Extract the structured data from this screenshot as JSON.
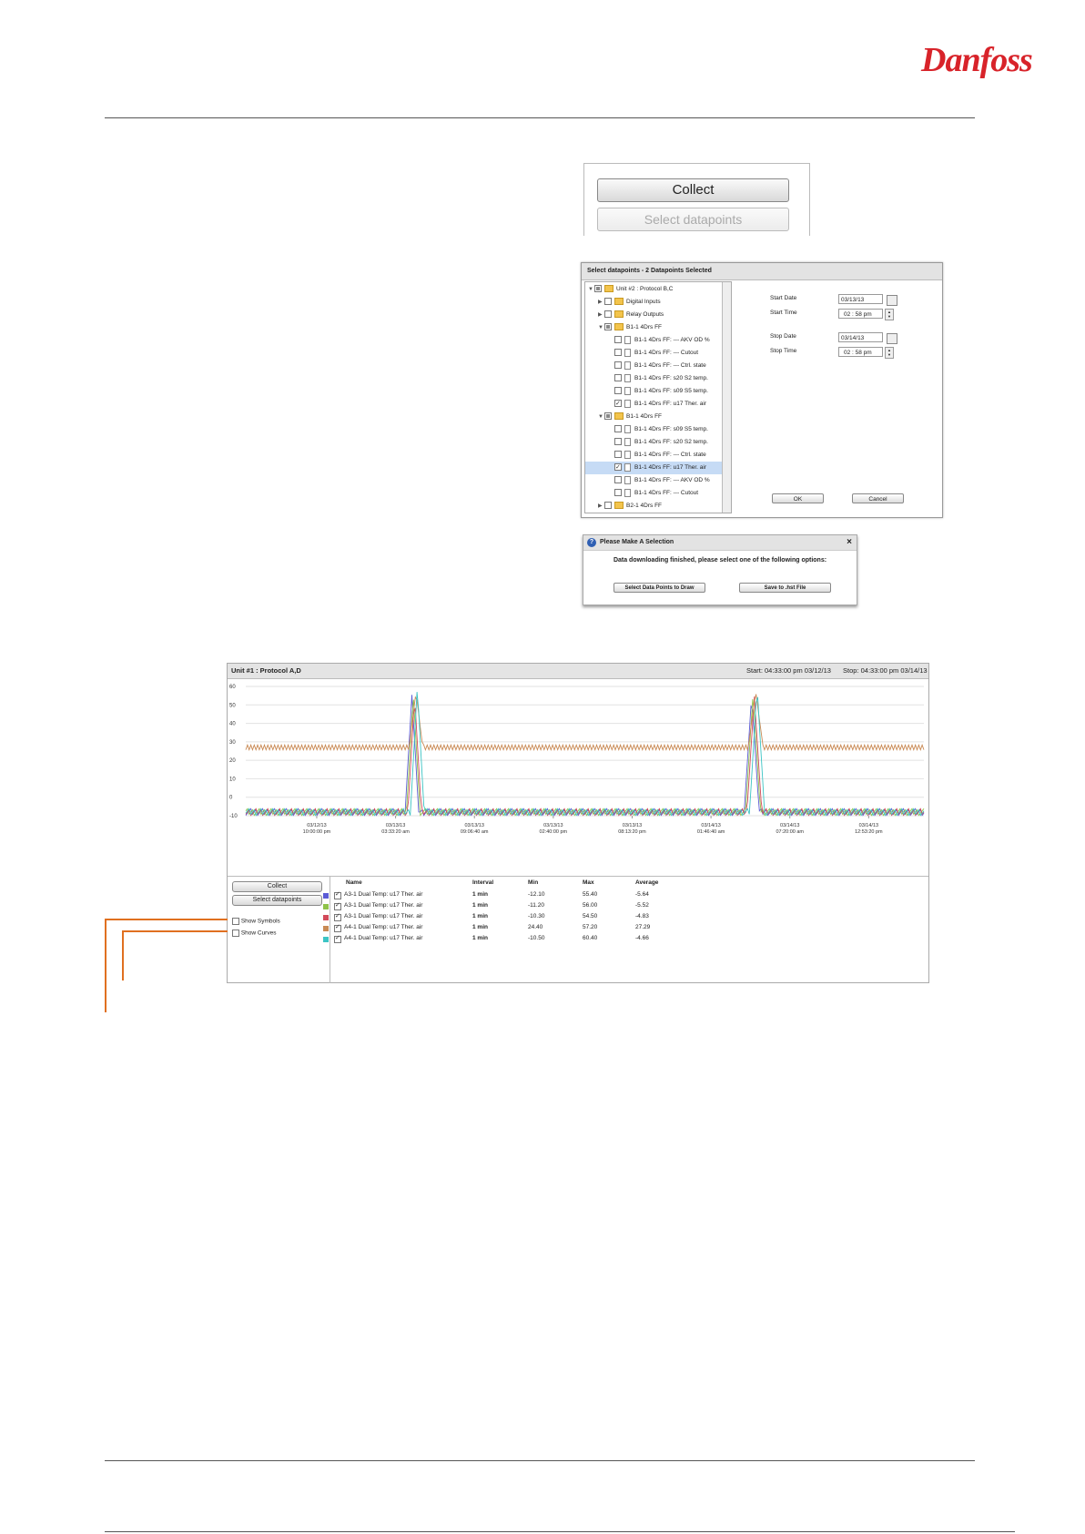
{
  "logo": {
    "text": "Danfoss",
    "color": "#d8232a"
  },
  "collect_panel": {
    "collect_label": "Collect",
    "select_label": "Select datapoints"
  },
  "select_dialog": {
    "title": "Select datapoints - 2 Datapoints Selected",
    "tree": [
      {
        "label": "Unit #2 : Protocol B,C",
        "level": 0,
        "arrow": "▼",
        "check": "part",
        "icon": "folder"
      },
      {
        "label": "Digital Inputs",
        "level": 1,
        "arrow": "▶",
        "check": "off",
        "icon": "folder"
      },
      {
        "label": "Relay Outputs",
        "level": 1,
        "arrow": "▶",
        "check": "off",
        "icon": "folder"
      },
      {
        "label": "B1-1 4Drs FF",
        "level": 1,
        "arrow": "▼",
        "check": "part",
        "icon": "folder"
      },
      {
        "label": "B1-1 4Drs FF:   --- AKV OD %",
        "level": 2,
        "arrow": "",
        "check": "off",
        "icon": "doc"
      },
      {
        "label": "B1-1 4Drs FF:   --- Cutout",
        "level": 2,
        "arrow": "",
        "check": "off",
        "icon": "doc"
      },
      {
        "label": "B1-1 4Drs FF:   --- Ctrl. state",
        "level": 2,
        "arrow": "",
        "check": "off",
        "icon": "doc"
      },
      {
        "label": "B1-1 4Drs FF:   s20 S2 temp.",
        "level": 2,
        "arrow": "",
        "check": "off",
        "icon": "doc"
      },
      {
        "label": "B1-1 4Drs FF:   s09 S5 temp.",
        "level": 2,
        "arrow": "",
        "check": "off",
        "icon": "doc"
      },
      {
        "label": "B1-1 4Drs FF:   u17 Ther. air",
        "level": 2,
        "arrow": "",
        "check": "on",
        "icon": "doc"
      },
      {
        "label": "B1-1 4Drs FF",
        "level": 1,
        "arrow": "▼",
        "check": "part",
        "icon": "folder"
      },
      {
        "label": "B1-1 4Drs FF:   s09 S5 temp.",
        "level": 2,
        "arrow": "",
        "check": "off",
        "icon": "doc"
      },
      {
        "label": "B1-1 4Drs FF:   s20 S2 temp.",
        "level": 2,
        "arrow": "",
        "check": "off",
        "icon": "doc"
      },
      {
        "label": "B1-1 4Drs FF:   --- Ctrl. state",
        "level": 2,
        "arrow": "",
        "check": "off",
        "icon": "doc"
      },
      {
        "label": "B1-1 4Drs FF:   u17 Ther. air",
        "level": 2,
        "arrow": "",
        "check": "on",
        "icon": "doc",
        "selected": true
      },
      {
        "label": "B1-1 4Drs FF:   --- AKV OD %",
        "level": 2,
        "arrow": "",
        "check": "off",
        "icon": "doc"
      },
      {
        "label": "B1-1 4Drs FF:   --- Cutout",
        "level": 2,
        "arrow": "",
        "check": "off",
        "icon": "doc"
      },
      {
        "label": "B2-1 4Drs FF",
        "level": 1,
        "arrow": "▶",
        "check": "off",
        "icon": "folder"
      }
    ],
    "start_date_label": "Start Date",
    "start_date": "03/13/13",
    "start_time_label": "Start Time",
    "start_time": "02 : 58  pm",
    "stop_date_label": "Stop Date",
    "stop_date": "03/14/13",
    "stop_time_label": "Stop Time",
    "stop_time": "02 : 58  pm",
    "ok_label": "OK",
    "cancel_label": "Cancel"
  },
  "message_dialog": {
    "title": "Please Make A Selection",
    "close": "×",
    "message": "Data downloading finished, please select one of the following options:",
    "draw_label": "Select Data Points to Draw",
    "save_label": "Save to .hst File"
  },
  "chart_window": {
    "title": "Unit #1 : Protocol A,D",
    "start": "Start: 04:33:00 pm  03/12/13",
    "stop": "Stop: 04:33:00 pm  03/14/13",
    "collect_label": "Collect",
    "select_label": "Select datapoints",
    "show_symbols": "Show Symbols",
    "show_curves": "Show Curves",
    "columns": {
      "name": "Name",
      "interval": "Interval",
      "min": "Min",
      "max": "Max",
      "average": "Average"
    },
    "legend_rows": [
      {
        "color": "#5b5bd6",
        "name": "A3-1 Dual Temp:   u17 Ther. air",
        "interval": "1 min",
        "min": "-12.10",
        "max": "55.40",
        "average": "-5.64"
      },
      {
        "color": "#8fc34a",
        "name": "A3-1 Dual Temp:   u17 Ther. air",
        "interval": "1 min",
        "min": "-11.20",
        "max": "56.00",
        "average": "-5.52"
      },
      {
        "color": "#d24a5a",
        "name": "A3-1 Dual Temp:   u17 Ther. air",
        "interval": "1 min",
        "min": "-10.30",
        "max": "54.50",
        "average": "-4.83"
      },
      {
        "color": "#c98a55",
        "name": "A4-1 Dual Temp:   u17 Ther. air",
        "interval": "1 min",
        "min": "24.40",
        "max": "57.20",
        "average": "27.29"
      },
      {
        "color": "#3cc4c4",
        "name": "A4-1 Dual Temp:   u17 Ther. air",
        "interval": "1 min",
        "min": "-10.50",
        "max": "60.40",
        "average": "-4.66"
      }
    ]
  },
  "chart_data": {
    "type": "line",
    "title": "",
    "xlabel": "",
    "ylabel": "",
    "ylim": [
      -10,
      60
    ],
    "yticks": [
      -10,
      0,
      10,
      20,
      30,
      40,
      50,
      60
    ],
    "xticks": [
      {
        "date": "03/12/13",
        "time": "10:00:00 pm"
      },
      {
        "date": "03/13/13",
        "time": "03:33:20 am"
      },
      {
        "date": "03/13/13",
        "time": "09:06:40 am"
      },
      {
        "date": "03/13/13",
        "time": "02:40:00 pm"
      },
      {
        "date": "03/13/13",
        "time": "08:13:20 pm"
      },
      {
        "date": "03/14/13",
        "time": "01:46:40 am"
      },
      {
        "date": "03/14/13",
        "time": "07:20:00 am"
      },
      {
        "date": "03/14/13",
        "time": "12:53:20 pm"
      }
    ],
    "grid": true,
    "series": [
      {
        "name": "A3-1 Dual Temp:   u17 Ther. air",
        "color": "#5b5bd6",
        "base": -8,
        "peak": 55.4
      },
      {
        "name": "A3-1 Dual Temp:   u17 Ther. air",
        "color": "#8fc34a",
        "base": -8,
        "peak": 56.0
      },
      {
        "name": "A3-1 Dual Temp:   u17 Ther. air",
        "color": "#d24a5a",
        "base": -8,
        "peak": 54.5
      },
      {
        "name": "A4-1 Dual Temp:   u17 Ther. air",
        "color": "#c98a55",
        "base": 27,
        "peak": 57.2
      },
      {
        "name": "A4-1 Dual Temp:   u17 Ther. air",
        "color": "#3cc4c4",
        "base": -8,
        "peak": 60.4
      }
    ]
  }
}
